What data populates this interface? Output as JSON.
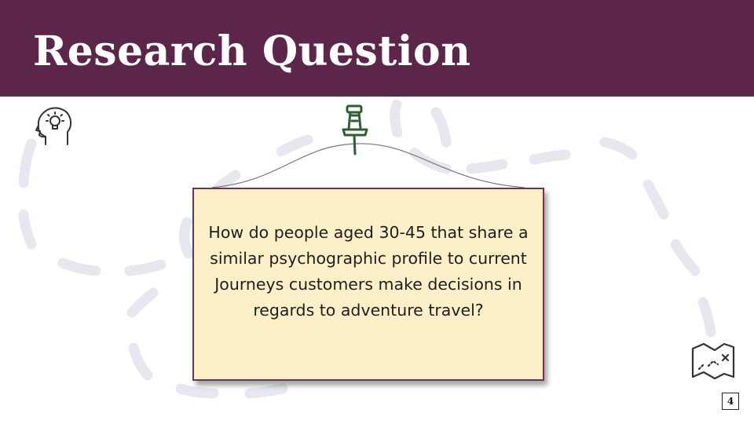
{
  "slide": {
    "title": "Research Question",
    "question": "How do people aged 30-45 that share a similar psychographic profile to current Journeys customers make decisions in regards to adventure travel?",
    "page_number": "4"
  },
  "colors": {
    "header_bg": "#5b2649",
    "note_bg": "#fdf0c9",
    "note_border": "#6e3355",
    "pin": "#2e5e32",
    "path_dashes": "#e7e7ef"
  },
  "icons": {
    "head": "head-with-lightbulb-icon",
    "pin": "pushpin-icon",
    "map": "treasure-map-icon"
  }
}
